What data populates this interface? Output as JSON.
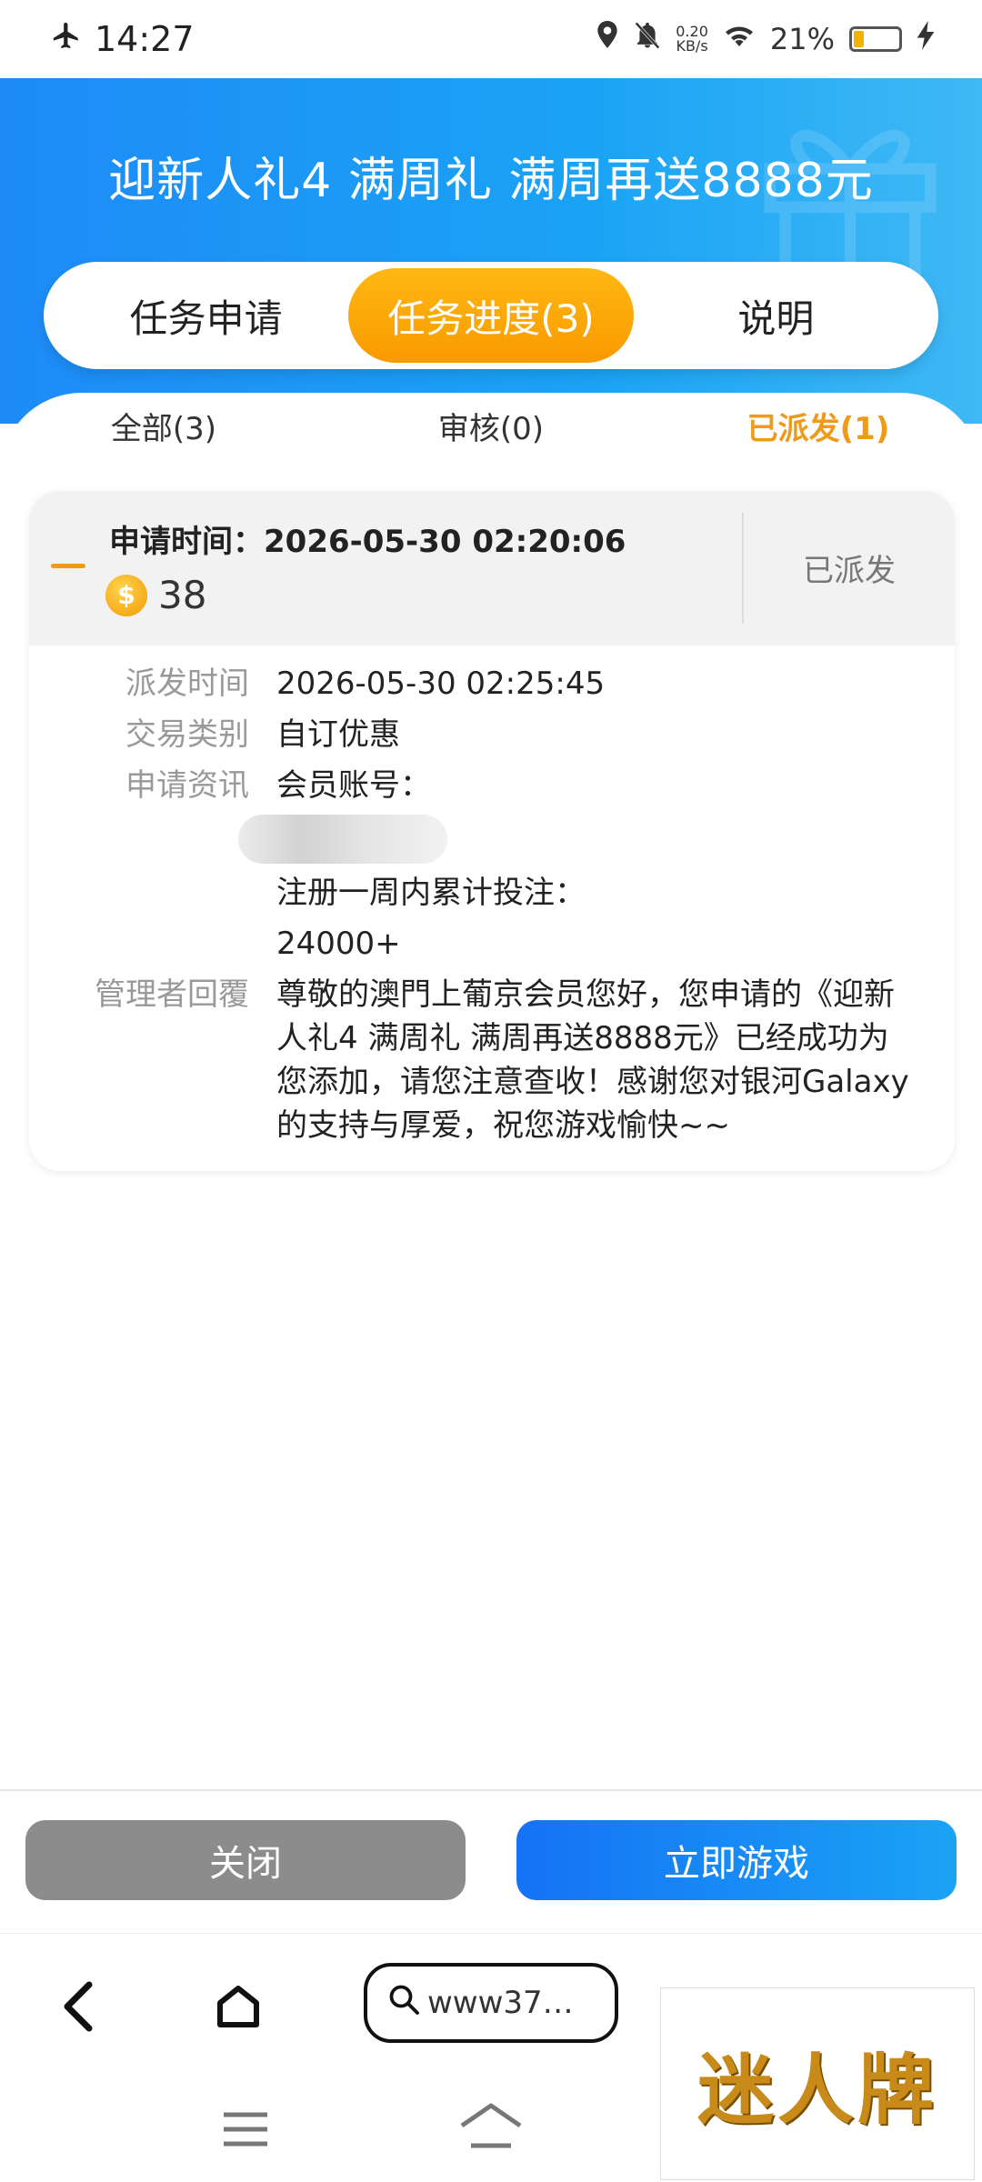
{
  "status_bar": {
    "time": "14:27",
    "net_speed_value": "0.20",
    "net_speed_unit": "KB/s",
    "battery": "21%",
    "battery_level": 0.21
  },
  "header": {
    "title": "迎新人礼4 满周礼 满周再送8888元"
  },
  "tabs": [
    {
      "label": "任务申请",
      "active": false
    },
    {
      "label": "任务进度(3)",
      "active": true
    },
    {
      "label": "说明",
      "active": false
    }
  ],
  "subtabs": [
    {
      "label": "全部(3)",
      "active": false
    },
    {
      "label": "审核(0)",
      "active": false
    },
    {
      "label": "已派发(1)",
      "active": true
    }
  ],
  "record": {
    "request_time_label": "申请时间：2026-05-30 02:20:06",
    "coin_symbol": "$",
    "amount": "38",
    "status": "已派发",
    "fields": {
      "dispatch_label": "派发时间",
      "dispatch_value": "2026-05-30 02:25:45",
      "type_label": "交易类别",
      "type_value": "自订优惠",
      "info_label": "申请资讯",
      "info_line1": "会员账号：",
      "info_line2": "注册一周内累计投注：",
      "info_line3": "24000+",
      "reply_label": "管理者回覆",
      "reply_value": "尊敬的澳門上葡京会员您好，您申请的《迎新人礼4 满周礼 满周再送8888元》已经成功为您添加，请您注意查收！感谢您对银河Galaxy的支持与厚爱，祝您游戏愉快~~"
    }
  },
  "buttons": {
    "close": "关闭",
    "play": "立即游戏"
  },
  "browser": {
    "url": "www37…"
  },
  "watermark": "迷人牌",
  "colors": {
    "header_blue": "#1e8bf7",
    "active_orange": "#f99a00",
    "close_gray": "#8c8c8c",
    "play_blue": "#1572f5"
  }
}
